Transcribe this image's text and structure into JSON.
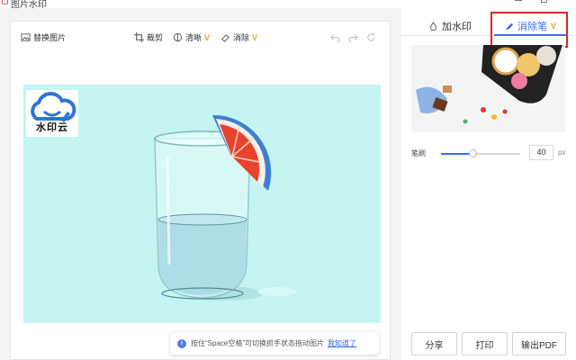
{
  "window": {
    "title": "图片水印"
  },
  "toolbar": {
    "replace_label": "替换图片",
    "crop_label": "裁剪",
    "sharpen_label": "清晰",
    "erase_label": "消除",
    "vip_badge": "V"
  },
  "watermark": {
    "text": "水印云"
  },
  "hint": {
    "text": "按住“Space空格”可切换抓手状态拖动图片",
    "link": "我知道了",
    "icon": "i"
  },
  "panel": {
    "tabs": [
      {
        "label": "加水印",
        "active": false
      },
      {
        "label": "消除笔",
        "active": true,
        "badge": "V"
      }
    ],
    "brush": {
      "label": "笔刷",
      "value": "40",
      "unit": "px",
      "level": 0.4
    },
    "buttons": {
      "share": "分享",
      "print": "打印",
      "export_pdf": "输出PDF"
    }
  },
  "colors": {
    "accent": "#3b6ff0",
    "vip": "#f0a51c",
    "highlight": "#e02424",
    "canvas_bg": "#c4f5f2"
  }
}
